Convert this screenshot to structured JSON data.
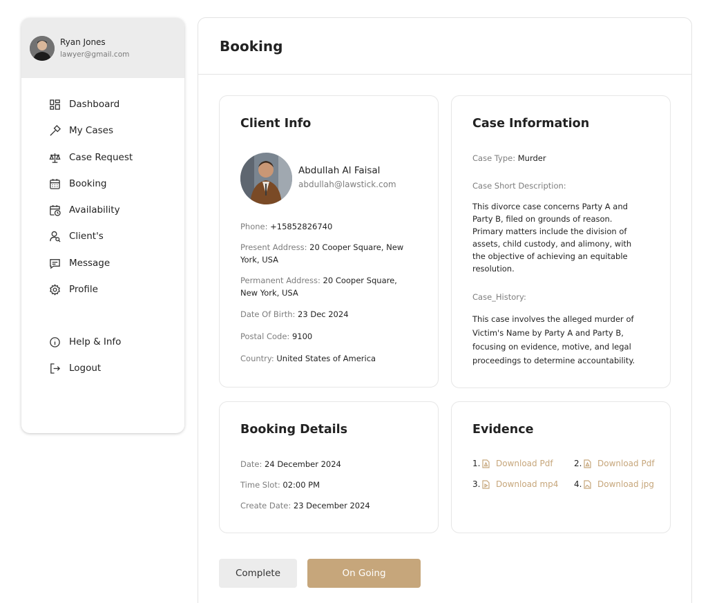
{
  "colors": {
    "accent": "#c6a67b",
    "muted": "#7d7d7d",
    "sidebar_header": "#ececec",
    "border": "#e3e3e3"
  },
  "user": {
    "name": "Ryan Jones",
    "email": "lawyer@gmail.com"
  },
  "nav": {
    "items": [
      {
        "label": "Dashboard",
        "icon": "dashboard-icon"
      },
      {
        "label": "My Cases",
        "icon": "hammer-icon"
      },
      {
        "label": "Case Request",
        "icon": "scales-icon"
      },
      {
        "label": "Booking",
        "icon": "calendar-icon"
      },
      {
        "label": "Availability",
        "icon": "calendar-clock-icon"
      },
      {
        "label": "Client's",
        "icon": "user-search-icon"
      },
      {
        "label": "Message",
        "icon": "chat-icon"
      },
      {
        "label": "Profile",
        "icon": "gear-icon"
      }
    ],
    "bottom": [
      {
        "label": "Help & Info",
        "icon": "info-icon"
      },
      {
        "label": "Logout",
        "icon": "logout-icon"
      }
    ]
  },
  "page": {
    "title": "Booking"
  },
  "client_info": {
    "title": "Client Info",
    "name": "Abdullah Al Faisal",
    "email": "abdullah@lawstick.com",
    "phone_label": "Phone:",
    "phone": "+15852826740",
    "present_label": "Present Address:",
    "present_line1": "20 Cooper Square, New",
    "present_line2": "York, USA",
    "permanent_label": "Permanent Address:",
    "permanent_line1": "20 Cooper Square,",
    "permanent_line2": "New York, USA",
    "dob_label": "Date Of Birth:",
    "dob": "23 Dec 2024",
    "postal_label": "Postal Code:",
    "postal": "9100",
    "country_label": "Country:",
    "country": "United States of America"
  },
  "case_info": {
    "title": "Case Information",
    "type_label": "Case Type:",
    "type": "Murder",
    "short_desc_label": "Case Short Description:",
    "short_desc": "This divorce case concerns Party A and Party B, filed on grounds of reason. Primary matters include the division of assets, child custody, and alimony, with the objective of achieving an equitable resolution.",
    "history_label": "Case_History:",
    "history": "This case involves the alleged murder of Victim's Name by Party A and Party B, focusing on evidence, motive, and legal proceedings to determine accountability."
  },
  "booking_details": {
    "title": "Booking Details",
    "date_label": "Date:",
    "date": "24 December 2024",
    "slot_label": "Time Slot:",
    "slot": "02:00 PM",
    "create_label": "Create Date:",
    "create": "23 December 2024"
  },
  "evidence": {
    "title": "Evidence",
    "items": [
      {
        "num": "1.",
        "label": "Download Pdf",
        "icon": "pdf-file-icon"
      },
      {
        "num": "2.",
        "label": "Download Pdf",
        "icon": "pdf-file-icon"
      },
      {
        "num": "3.",
        "label": "Download mp4",
        "icon": "video-file-icon"
      },
      {
        "num": "4.",
        "label": "Download jpg",
        "icon": "image-file-icon"
      }
    ]
  },
  "actions": {
    "complete": "Complete",
    "ongoing": "On Going"
  }
}
